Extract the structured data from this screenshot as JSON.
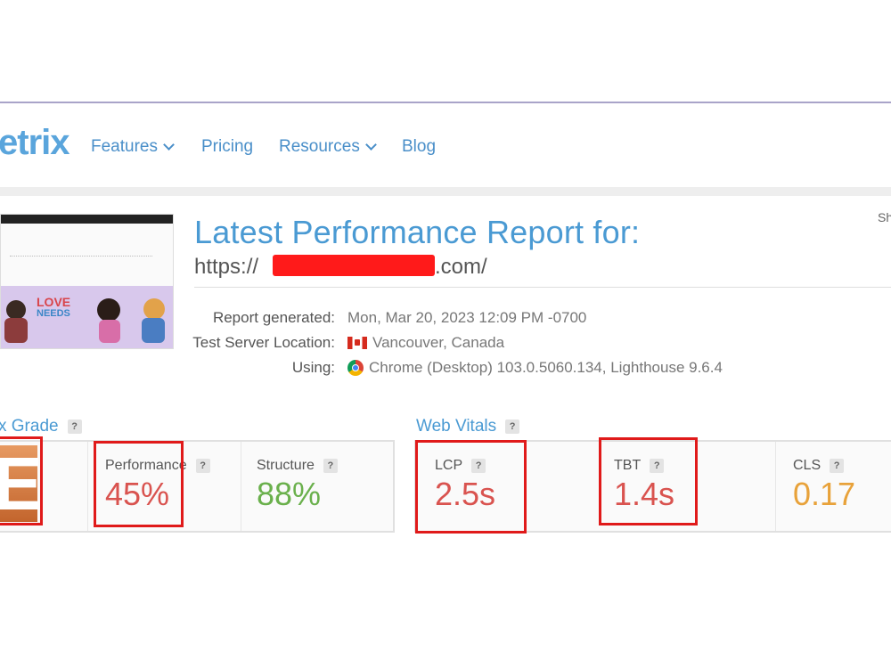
{
  "header": {
    "logo": "etrix",
    "nav": [
      {
        "label": "Features",
        "dropdown": true
      },
      {
        "label": "Pricing",
        "dropdown": false
      },
      {
        "label": "Resources",
        "dropdown": true
      },
      {
        "label": "Blog",
        "dropdown": false
      }
    ]
  },
  "report": {
    "title": "Latest Performance Report for:",
    "url_prefix": "https://",
    "url_suffix": ".com/",
    "share_label": "Sh",
    "report_generated_label": "Report generated:",
    "report_generated_value": "Mon, Mar 20, 2023 12:09 PM -0700",
    "server_label": "Test Server Location:",
    "server_value": "Vancouver, Canada",
    "using_label": "Using:",
    "using_value": "Chrome (Desktop) 103.0.5060.134, Lighthouse 9.6.4"
  },
  "thumbnail": {
    "banner_text_line1": "LOVE",
    "banner_text_line2": "NEEDS"
  },
  "grade": {
    "title": "x Grade",
    "help": "?",
    "letter": "E",
    "performance_label": "Performance",
    "performance_value": "45%",
    "structure_label": "Structure",
    "structure_value": "88%"
  },
  "vitals": {
    "title": "Web Vitals",
    "help": "?",
    "lcp_label": "LCP",
    "lcp_value": "2.5s",
    "tbt_label": "TBT",
    "tbt_value": "1.4s",
    "cls_label": "CLS",
    "cls_value": "0.17"
  },
  "colors": {
    "accent": "#4a9ad3",
    "bad": "#d9534f",
    "good": "#6ab04c",
    "warn": "#e8a23a",
    "highlight": "#e01a1a"
  }
}
